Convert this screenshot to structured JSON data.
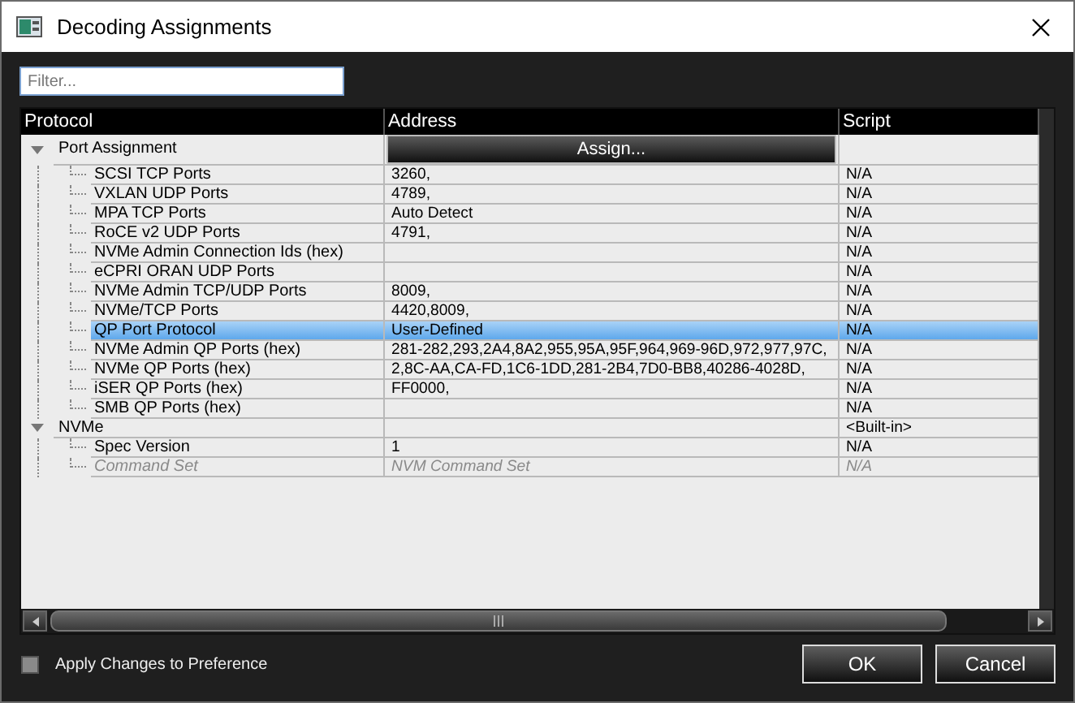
{
  "window": {
    "title": "Decoding Assignments"
  },
  "filter": {
    "placeholder": "Filter..."
  },
  "table": {
    "columns": [
      "Protocol",
      "Address",
      "Script"
    ],
    "groups": [
      {
        "label": "Port Assignment",
        "expanded": true,
        "button": "Assign...",
        "children": [
          {
            "label": "SCSI TCP Ports",
            "address": "3260,",
            "script": "N/A",
            "selected": false,
            "disabled": false
          },
          {
            "label": "VXLAN UDP Ports",
            "address": "4789,",
            "script": "N/A",
            "selected": false,
            "disabled": false
          },
          {
            "label": "MPA TCP Ports",
            "address": "Auto Detect",
            "script": "N/A",
            "selected": false,
            "disabled": false
          },
          {
            "label": "RoCE v2 UDP Ports",
            "address": "4791,",
            "script": "N/A",
            "selected": false,
            "disabled": false
          },
          {
            "label": "NVMe Admin Connection Ids (hex)",
            "script": "N/A",
            "selected": false,
            "disabled": false
          },
          {
            "label": "eCPRI ORAN UDP Ports",
            "script": "N/A",
            "selected": false,
            "disabled": false
          },
          {
            "label": "NVMe Admin TCP/UDP Ports",
            "address": "8009,",
            "script": "N/A",
            "selected": false,
            "disabled": false
          },
          {
            "label": "NVMe/TCP Ports",
            "address": "4420,8009,",
            "script": "N/A",
            "selected": false,
            "disabled": false
          },
          {
            "label": "QP Port Protocol",
            "address": "User-Defined",
            "script": "N/A",
            "selected": true,
            "disabled": false
          },
          {
            "label": "NVMe Admin QP Ports (hex)",
            "address": "281-282,293,2A4,8A2,955,95A,95F,964,969-96D,972,977,97C,",
            "script": "N/A",
            "selected": false,
            "disabled": false
          },
          {
            "label": "NVMe QP Ports (hex)",
            "address": "2,8C-AA,CA-FD,1C6-1DD,281-2B4,7D0-BB8,40286-4028D,",
            "script": "N/A",
            "selected": false,
            "disabled": false
          },
          {
            "label": "iSER QP Ports (hex)",
            "address": "FF0000,",
            "script": "N/A",
            "selected": false,
            "disabled": false
          },
          {
            "label": "SMB QP Ports (hex)",
            "script": "N/A",
            "selected": false,
            "disabled": false
          }
        ]
      },
      {
        "label": "NVMe",
        "expanded": true,
        "script": "<Built-in>",
        "children": [
          {
            "label": "Spec Version",
            "address": "1",
            "script": "N/A",
            "selected": false,
            "disabled": false
          },
          {
            "label": "Command Set",
            "address": "NVM Command Set",
            "script": "N/A",
            "selected": false,
            "disabled": true
          }
        ]
      }
    ]
  },
  "apply_checkbox": {
    "label": "Apply Changes to Preference",
    "checked": false
  },
  "buttons": [
    "OK",
    "Cancel"
  ]
}
